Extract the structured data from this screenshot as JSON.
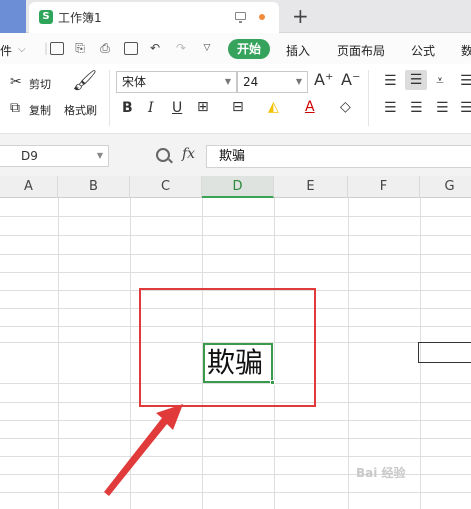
{
  "app": {
    "doc_tab": "工作簿1",
    "logo_letter": "S"
  },
  "menu": {
    "file": "件",
    "tabs": [
      "开始",
      "插入",
      "页面布局",
      "公式",
      "数"
    ]
  },
  "ribbon": {
    "cut": "剪切",
    "copy": "复制",
    "format_painter": "格式刷",
    "font_name": "宋体",
    "font_size": "24",
    "bold": "B",
    "italic": "I",
    "underline": "U"
  },
  "formula_bar": {
    "name_box": "D9",
    "fx": "fx",
    "content": "欺骗"
  },
  "sheet": {
    "columns": [
      "A",
      "B",
      "C",
      "D",
      "E",
      "F",
      "G"
    ],
    "selected_column": "D",
    "selected_cell_value": "欺骗"
  },
  "watermark": "Bai 经验",
  "colors": {
    "accent_green": "#35a35b",
    "annotation_red": "#e03a3a",
    "left_strip": "#6c8ed6"
  }
}
